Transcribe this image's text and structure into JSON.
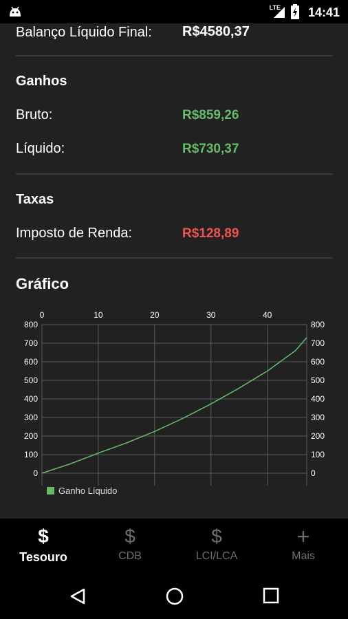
{
  "status": {
    "time": "14:41",
    "network": "LTE"
  },
  "summary": {
    "final_label": "Balanço Líquido Final:",
    "final_value": "R$4580,37"
  },
  "ganhos": {
    "title": "Ganhos",
    "bruto_label": "Bruto:",
    "bruto_value": "R$859,26",
    "liquido_label": "Líquido:",
    "liquido_value": "R$730,37"
  },
  "taxas": {
    "title": "Taxas",
    "ir_label": "Imposto de Renda:",
    "ir_value": "R$128,89"
  },
  "grafico": {
    "title": "Gráfico"
  },
  "chart_data": {
    "type": "line",
    "x": [
      0,
      5,
      10,
      15,
      20,
      25,
      30,
      35,
      40,
      45,
      47
    ],
    "series": [
      {
        "name": "Ganho Líquido",
        "values": [
          0,
          50,
          108,
          163,
          225,
          295,
          373,
          458,
          550,
          660,
          730
        ]
      }
    ],
    "xticks": [
      "0",
      "10",
      "20",
      "30",
      "40"
    ],
    "yticks": [
      "0",
      "100",
      "200",
      "300",
      "400",
      "500",
      "600",
      "700",
      "800"
    ],
    "xlim": [
      0,
      47
    ],
    "ylim": [
      0,
      800
    ],
    "grid": true,
    "legend": "bottom-left",
    "colors": {
      "line": "#66bb6a",
      "grid": "#5a5a5a"
    }
  },
  "bottom_nav": {
    "items": [
      {
        "label": "Tesouro",
        "icon": "$"
      },
      {
        "label": "CDB",
        "icon": "$"
      },
      {
        "label": "LCI/LCA",
        "icon": "$"
      },
      {
        "label": "Mais",
        "icon": "+"
      }
    ]
  }
}
